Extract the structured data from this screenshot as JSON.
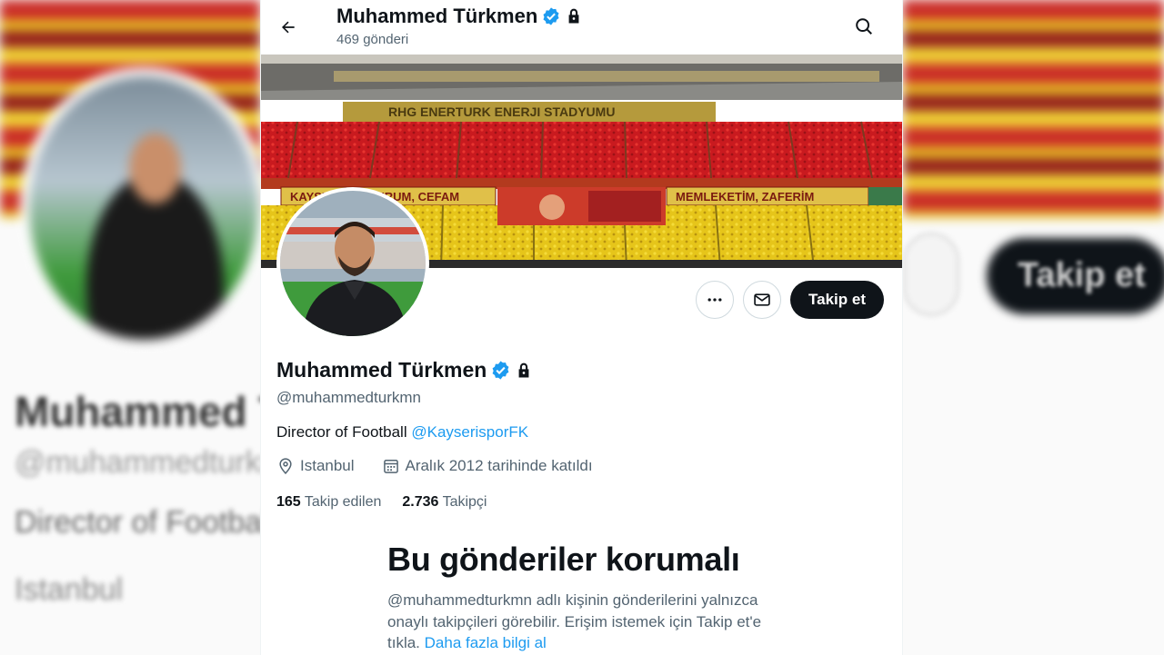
{
  "header": {
    "display_name": "Muhammed Türkmen",
    "post_count": "469 gönderi"
  },
  "icons": {
    "back": "arrow-left-icon",
    "verified": "verified-badge-icon",
    "lock": "lock-icon",
    "search": "search-icon",
    "more": "more-dots-icon",
    "message": "envelope-icon",
    "location": "location-pin-icon",
    "calendar": "calendar-icon"
  },
  "profile": {
    "display_name": "Muhammed Türkmen",
    "handle": "@muhammedturkmn",
    "bio_text": "Director of Football ",
    "bio_mention": "@KayserisporFK",
    "location": "Istanbul",
    "joined": "Aralık 2012 tarihinde katıldı",
    "following_count": "165",
    "following_label": "Takip edilen",
    "followers_count": "2.736",
    "followers_label": "Takipçi",
    "follow_button": "Takip et"
  },
  "protected_notice": {
    "title": "Bu gönderiler korumalı",
    "body": "@muhammedturkmn adlı kişinin gönderilerini yalnızca onaylı takipçileri görebilir. Erişim istemek için Takip et'e tıkla.",
    "link": "Daha fazla bilgi al"
  },
  "banner": {
    "stadium_sign": "RHG ENERTURK ENERJI STADYUMU",
    "banner_left": "KAYSERI'SİN BURUM, CEFAM",
    "banner_right": "MEMLEKETİM, ZAFERİM"
  },
  "colors": {
    "accent": "#1d9bf0",
    "text_primary": "#0f1419",
    "text_secondary": "#536471",
    "button_dark": "#0f1419"
  }
}
